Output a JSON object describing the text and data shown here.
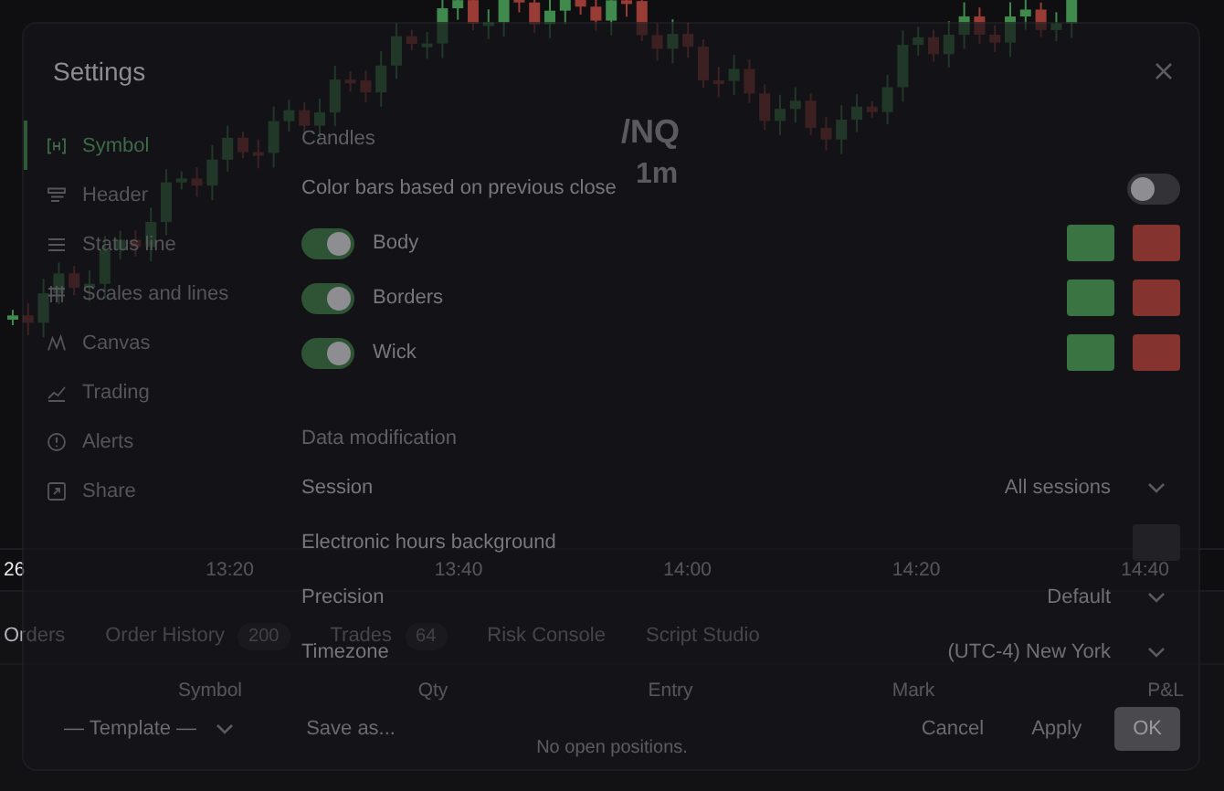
{
  "chart": {
    "legend_symbol": "/NQ",
    "legend_interval": "1m",
    "time_labels": [
      "26",
      "13:20",
      "13:40",
      "14:00",
      "14:20",
      "14:40"
    ]
  },
  "bottom_panel": {
    "tabs": [
      {
        "label": "Orders",
        "selected": false
      },
      {
        "label": "Order History",
        "count": "200",
        "selected": false
      },
      {
        "label": "Trades",
        "count": "64",
        "selected": false
      },
      {
        "label": "Risk Console",
        "selected": false
      },
      {
        "label": "Script Studio",
        "selected": false
      }
    ],
    "columns": [
      "Symbol",
      "Qty",
      "Entry",
      "Mark",
      "P&L"
    ],
    "empty_message": "No open positions."
  },
  "dialog": {
    "title": "Settings",
    "sidebar": [
      {
        "label": "Symbol",
        "selected": true
      },
      {
        "label": "Header",
        "selected": false
      },
      {
        "label": "Status line",
        "selected": false
      },
      {
        "label": "Scales and lines",
        "selected": false
      },
      {
        "label": "Canvas",
        "selected": false
      },
      {
        "label": "Trading",
        "selected": false
      },
      {
        "label": "Alerts",
        "selected": false
      },
      {
        "label": "Share",
        "selected": false
      }
    ],
    "sections": [
      {
        "heading": "Candles",
        "rows": [
          {
            "kind": "toggle",
            "label": "Color bars based on previous close",
            "on": false
          },
          {
            "kind": "colors",
            "label": "Body",
            "on": true,
            "swatches": [
              {
                "color": "#3b7443"
              },
              {
                "color": "#84332f"
              }
            ]
          },
          {
            "kind": "colors",
            "label": "Borders",
            "on": true,
            "swatches": [
              {
                "color": "#3b7443"
              },
              {
                "color": "#84332f"
              }
            ]
          },
          {
            "kind": "colors",
            "label": "Wick",
            "on": true,
            "swatches": [
              {
                "color": "#3b7443"
              },
              {
                "color": "#84332f"
              }
            ]
          }
        ]
      },
      {
        "heading": "Data modification",
        "rows": [
          {
            "kind": "select",
            "label": "Session",
            "value": "All sessions"
          },
          {
            "kind": "color",
            "label": "Electronic hours background",
            "color": "#222226"
          },
          {
            "kind": "select",
            "label": "Precision",
            "value": "Default"
          },
          {
            "kind": "select",
            "label": "Timezone",
            "value": "(UTC-4) New York"
          }
        ]
      }
    ],
    "footer": {
      "template": "— Template —",
      "save": "Save as...",
      "buttons": [
        {
          "label": "Cancel",
          "primary": false
        },
        {
          "label": "Apply",
          "primary": false
        },
        {
          "label": "OK",
          "primary": true
        }
      ]
    }
  }
}
